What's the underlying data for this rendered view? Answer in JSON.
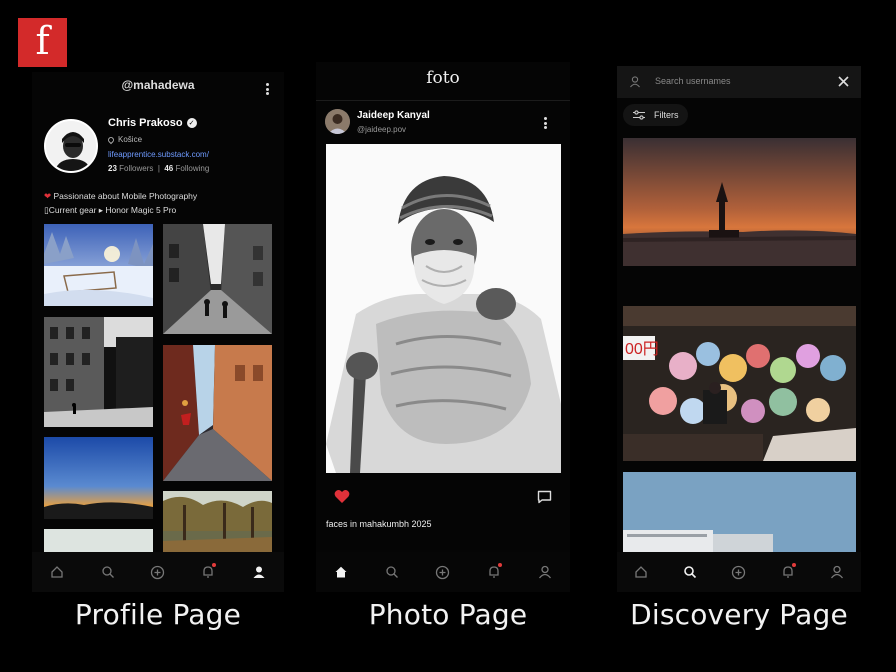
{
  "logo_letter": "f",
  "captions": {
    "profile": "Profile Page",
    "photo": "Photo Page",
    "discovery": "Discovery Page"
  },
  "profile": {
    "handle": "@mahadewa",
    "name": "Chris Prakoso",
    "location": "Košice",
    "link": "lifeapprentice.substack.com/",
    "followers_count": "23",
    "followers_label": "Followers",
    "following_count": "46",
    "following_label": "Following",
    "bio_line1": "Passionate about Mobile Photography",
    "bio_line2": "Current gear ▸ Honor Magic 5 Pro"
  },
  "photo": {
    "brand": "foto",
    "user_name": "Jaideep Kanyal",
    "user_handle": "@jaideep.pov",
    "caption": "faces in mahakumbh 2025",
    "liked": true
  },
  "discovery": {
    "search_placeholder": "Search usernames",
    "filters_label": "Filters"
  },
  "tabbar": {
    "items": [
      "home-icon",
      "search-icon",
      "add-icon",
      "notifications-icon",
      "profile-icon"
    ]
  },
  "colors": {
    "accent_red": "#e0313a",
    "link_blue": "#6f9bff",
    "logo_red": "#d32a2a",
    "background": "#000000"
  }
}
